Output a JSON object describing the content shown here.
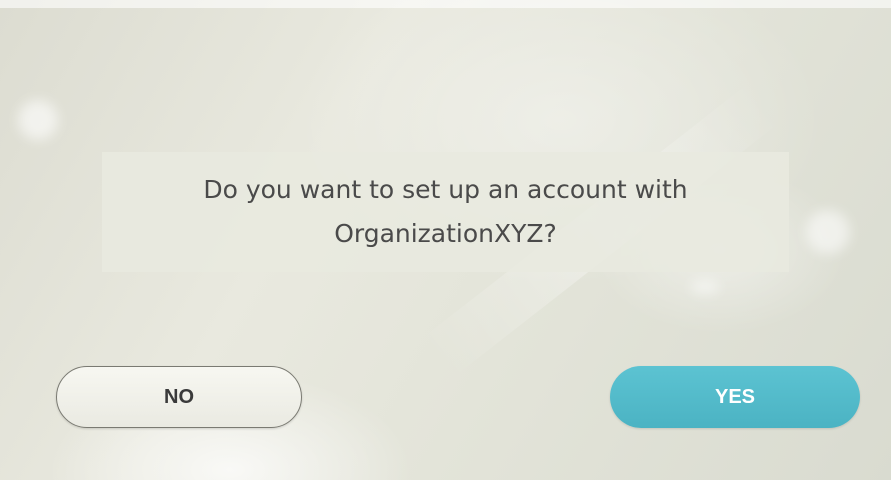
{
  "dialog": {
    "message_lines": [
      "Do you want to set up an account with",
      "OrganizationXYZ?"
    ],
    "no_label": "NO",
    "yes_label": "YES"
  },
  "colors": {
    "yes_button": "#4bb3c3",
    "no_button_border": "#7a7a72",
    "panel_background": "#e8e9df"
  }
}
